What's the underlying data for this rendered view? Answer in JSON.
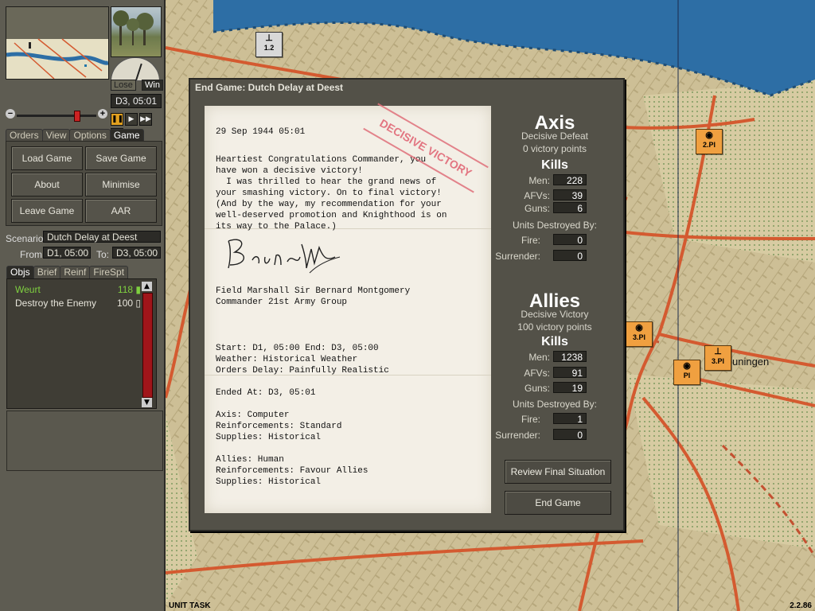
{
  "map": {
    "units": [
      {
        "label": "1.2",
        "style": "grey",
        "sym": "⊥"
      },
      {
        "label": "2.Pl",
        "style": "orange",
        "sym": "◉"
      },
      {
        "label": "3.Pl",
        "style": "orange",
        "sym": "◉"
      },
      {
        "label": "Pl",
        "style": "orange",
        "sym": "◉"
      },
      {
        "label": "3.Pl",
        "style": "orange",
        "sym": "⊥"
      }
    ],
    "town": "uningen",
    "status_left": "UNIT TASK",
    "version": "2.2.86"
  },
  "panel": {
    "lose": "Lose",
    "win": "Win",
    "date": "D3, 05:01",
    "tabs": [
      "Orders",
      "View",
      "Options",
      "Game"
    ],
    "active_tab": "Game",
    "buttons": {
      "load": "Load Game",
      "save": "Save Game",
      "about": "About",
      "minimise": "Minimise",
      "leave": "Leave Game",
      "aar": "AAR"
    },
    "scenario_label": "Scenario:",
    "scenario": "Dutch Delay at Deest",
    "from_label": "From:",
    "from": "D1, 05:00",
    "to_label": "To:",
    "to": "D3, 05:00",
    "subtabs": [
      "Objs",
      "Brief",
      "Reinf",
      "FireSpt"
    ],
    "objectives": [
      {
        "name": "Weurt",
        "value": "118",
        "color": "#7fd040"
      },
      {
        "name": "Destroy the Enemy",
        "value": "100",
        "color": "#e8e6dc"
      }
    ]
  },
  "dialog": {
    "title": "End Game: Dutch Delay at Deest",
    "stamp": "DECISIVE VICTORY",
    "letter": {
      "date": "29 Sep 1944 05:01",
      "body": "Heartiest Congratulations Commander, you\nhave won a decisive victory!\n  I was thrilled to hear the grand news of\nyour smashing victory. On to final victory!\n(And by the way, my recommendation for your\nwell-deserved promotion and Knighthood is on\nits way to the Palace.)",
      "signoff": "Field Marshall Sir Bernard Montgomery\nCommander 21st Army Group",
      "info1": "Start: D1, 05:00 End: D3, 05:00\nWeather: Historical Weather\nOrders Delay: Painfully Realistic",
      "info2": "Ended At: D3, 05:01",
      "info3": "Axis: Computer\nReinforcements: Standard\nSupplies: Historical",
      "info4": "Allies: Human\nReinforcements: Favour Allies\nSupplies: Historical"
    },
    "axis": {
      "name": "Axis",
      "result": "Decisive Defeat",
      "points": "0 victory points",
      "kills_label": "Kills",
      "men_label": "Men:",
      "men": "228",
      "afvs_label": "AFVs:",
      "afvs": "39",
      "guns_label": "Guns:",
      "guns": "6",
      "ud_label": "Units Destroyed By:",
      "fire_label": "Fire:",
      "fire": "0",
      "surrender_label": "Surrender:",
      "surrender": "0"
    },
    "allies": {
      "name": "Allies",
      "result": "Decisive Victory",
      "points": "100 victory points",
      "kills_label": "Kills",
      "men_label": "Men:",
      "men": "1238",
      "afvs_label": "AFVs:",
      "afvs": "91",
      "guns_label": "Guns:",
      "guns": "19",
      "ud_label": "Units Destroyed By:",
      "fire_label": "Fire:",
      "fire": "1",
      "surrender_label": "Surrender:",
      "surrender": "0"
    },
    "review_button": "Review Final Situation",
    "end_button": "End Game"
  }
}
